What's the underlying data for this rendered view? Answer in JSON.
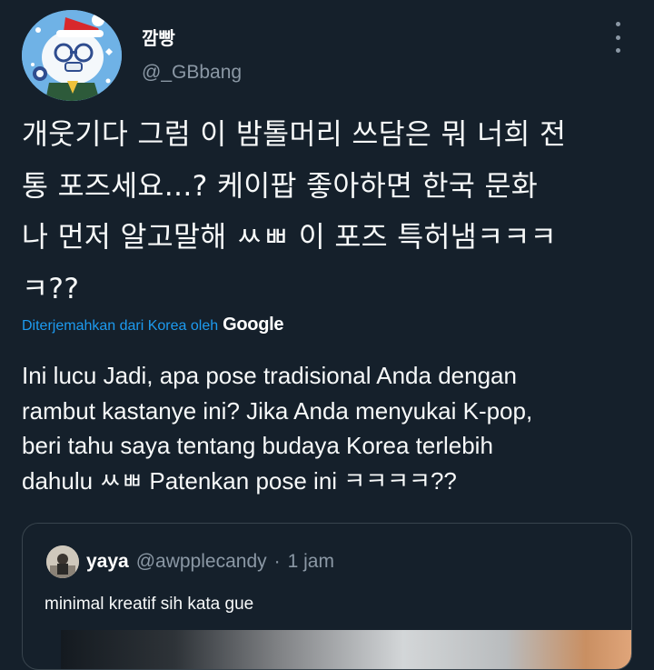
{
  "author": {
    "display_name": "깜빵",
    "handle": "@_GBbang"
  },
  "tweet": {
    "text_lines": [
      "개웃기다 그럼 이 밤톨머리 쓰담은 뭐 너희 전",
      "통 포즈세요...? 케이팝 좋아하면 한국 문화",
      "나 먼저 알고말해 ㅆㅃ 이 포즈 특허냄ㅋㅋㅋ",
      "ㅋ??"
    ],
    "translated_label": "Diterjemahkan dari Korea oleh",
    "translator_logo": "Google",
    "translation_lines": [
      "Ini lucu Jadi, apa pose tradisional Anda dengan",
      "rambut kastanye ini? Jika Anda menyukai K-pop,",
      "beri tahu saya tentang budaya Korea terlebih",
      "dahulu ㅆㅃ Patenkan pose ini ㅋㅋㅋㅋ??"
    ]
  },
  "quoted_tweet": {
    "name": "yaya",
    "handle": "@awpplecandy",
    "separator": "·",
    "time": "1 jam",
    "text": "minimal kreatif sih kata gue"
  },
  "icons": {
    "more": "more-options-icon"
  },
  "colors": {
    "background": "#15202b",
    "text": "#f7f9f9",
    "secondary_text": "#8b98a5",
    "link": "#1d9bf0",
    "border": "#38444d"
  }
}
